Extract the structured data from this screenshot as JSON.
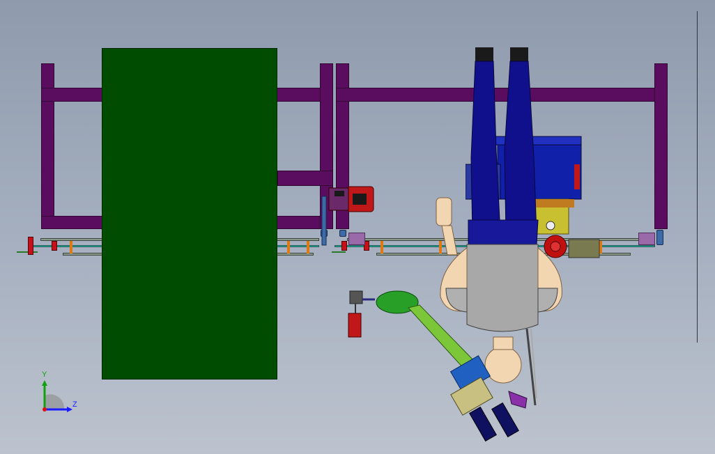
{
  "viewport": {
    "background_top": "#8f9bad",
    "background_bottom": "#bcc3ce"
  },
  "colors": {
    "frame": "#5a0d5e",
    "panel": "#004c00",
    "robot_arm": "#7cc63a",
    "legs": "#10108c",
    "torso": "#a8a8a8",
    "skin": "#f2d6b2"
  },
  "triad": {
    "y_label": "Y",
    "z_label": "Z"
  }
}
